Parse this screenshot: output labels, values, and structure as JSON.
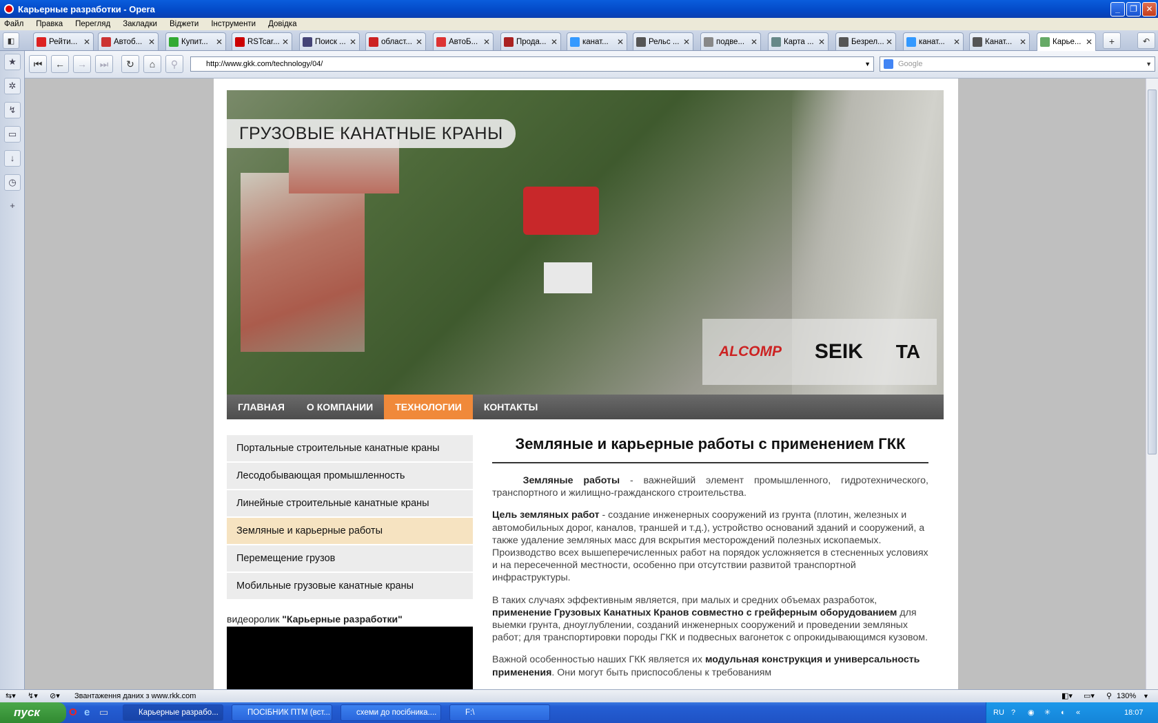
{
  "window": {
    "title": "Карьерные разработки - Opera"
  },
  "menu": [
    "Файл",
    "Правка",
    "Перегляд",
    "Закладки",
    "Віджети",
    "Інструменти",
    "Довідка"
  ],
  "tabs": [
    {
      "label": "Рейти...",
      "color": "#d22"
    },
    {
      "label": "Автоб...",
      "color": "#c33"
    },
    {
      "label": "Купит...",
      "color": "#3a3"
    },
    {
      "label": "RSTcar...",
      "color": "#c00"
    },
    {
      "label": "Поиск ...",
      "color": "#447"
    },
    {
      "label": "област...",
      "color": "#c22"
    },
    {
      "label": "АвтоБ...",
      "color": "#d33"
    },
    {
      "label": "Прода...",
      "color": "#a22"
    },
    {
      "label": "канат...",
      "color": "#39f"
    },
    {
      "label": "Рельс ...",
      "color": "#555"
    },
    {
      "label": "подве...",
      "color": "#888"
    },
    {
      "label": "Карта ...",
      "color": "#688"
    },
    {
      "label": "Безрел...",
      "color": "#555"
    },
    {
      "label": "канат...",
      "color": "#39f"
    },
    {
      "label": "Канат...",
      "color": "#555"
    },
    {
      "label": "Карье...",
      "color": "#6a6"
    }
  ],
  "address": {
    "url": "http://www.gkk.com/technology/04/",
    "search_placeholder": "Google"
  },
  "hero": {
    "title": "ГРУЗОВЫЕ КАНАТНЫЕ КРАНЫ",
    "logos": [
      "ALCOMP",
      "SEIK",
      "TA"
    ]
  },
  "nav": [
    "ГЛАВНАЯ",
    "О КОМПАНИИ",
    "ТЕХНОЛОГИИ",
    "КОНТАКТЫ"
  ],
  "sidebar": [
    "Портальные строительные канатные краны",
    "Лесодобывающая промышленность",
    "Линейные строительные канатные краны",
    "Земляные и карьерные работы",
    "Перемещение грузов",
    "Мобильные грузовые канатные краны"
  ],
  "video": {
    "prefix": "видеоролик ",
    "title": "\"Карьерные разработки\""
  },
  "article": {
    "h1": "Земляные и карьерные работы с применением ГКК",
    "p1b": "Земляные работы",
    "p1": " - важнейший элемент промышленного, гидротехнического, транспортного и  жилищно-гражданского строительства.",
    "p2b": "Цель земляных работ",
    "p2": " - создание инженерных сооружений из грунта (плотин, железных и автомобильных дорог, каналов, траншей и т.д.), устройство оснований зданий и сооружений, а также удаление земляных масс для вскрытия месторождений полезных ископаемых. Производство всех вышеперечисленных работ на порядок усложняется в стесненных условиях и на пересеченной местности, особенно при отсутствии развитой транспортной инфраструктуры.",
    "p3a": "В таких случаях эффективным является, при малых и средних объемах разработок, ",
    "p3b": "применение Грузовых Канатных Кранов совместно с грейферным оборудованием",
    "p3c": " для выемки грунта, дноуглублении, созданий инженерных сооружений и проведении земляных работ; для транспортировки породы ГКК и подвесных вагонеток с опрокидывающимся кузовом.",
    "p4a": "Важной особенностью наших ГКК является их ",
    "p4b": "модульная конструкция и универсальность применения",
    "p4c": ". Они могут быть приспособлены к требованиям"
  },
  "status": {
    "text": "Звантаження даних з www.rkk.com",
    "zoom": "130%"
  },
  "taskbar": {
    "start": "пуск",
    "items": [
      "Карьерные разрабо...",
      "ПОСІБНИК ПТМ (вст...",
      "схеми до посібника....",
      "F:\\"
    ],
    "lang": "RU",
    "time": "18:07"
  }
}
